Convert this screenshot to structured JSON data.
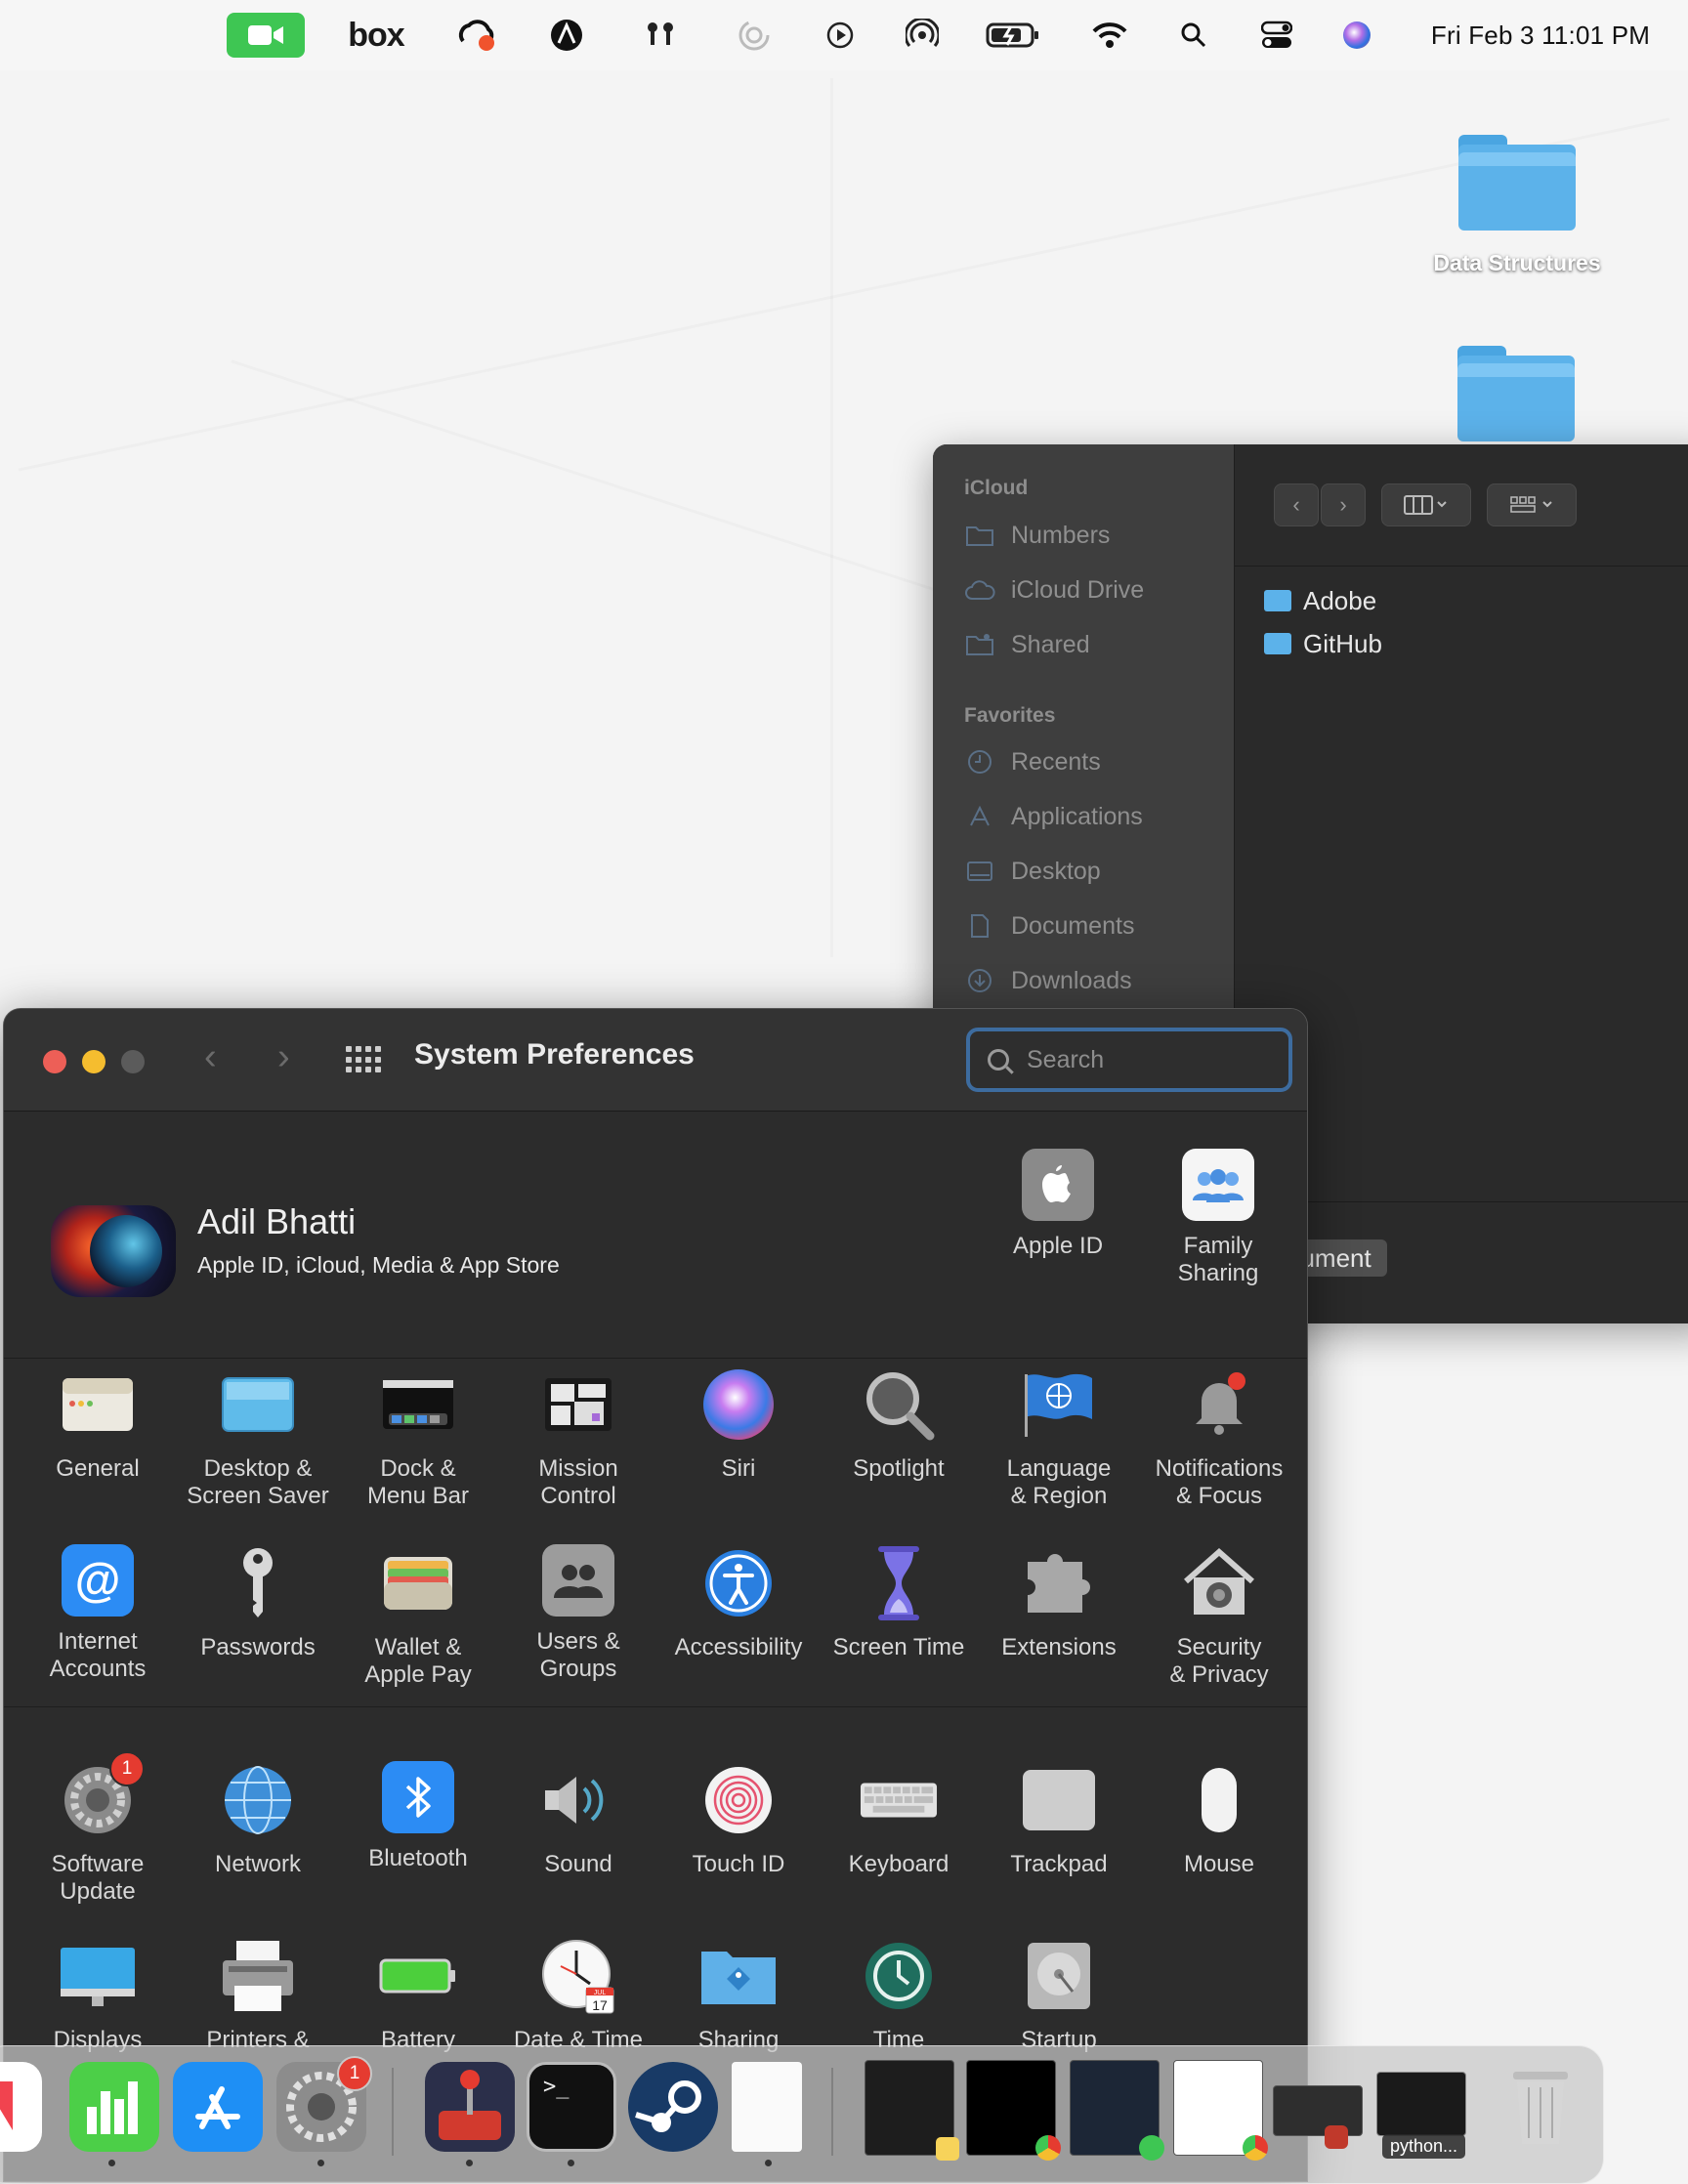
{
  "menubar": {
    "clock": "Fri Feb 3  11:01 PM",
    "box_label": "box",
    "icons": [
      "facetime-icon",
      "box-icon",
      "creative-cloud-icon",
      "cleanmymac-icon",
      "airpods-icon",
      "focus-icon",
      "play-icon",
      "airdrop-icon",
      "battery-icon",
      "wifi-icon",
      "search-icon",
      "control-center-icon",
      "siri-icon"
    ]
  },
  "desktop": {
    "folders": [
      {
        "label": "Data Structures"
      },
      {
        "label": ""
      }
    ]
  },
  "finder": {
    "sidebar": {
      "icloud_header": "iCloud",
      "icloud_items": [
        "Numbers",
        "iCloud Drive",
        "Shared"
      ],
      "favorites_header": "Favorites",
      "favorites_items": [
        "Recents",
        "Applications",
        "Desktop",
        "Documents",
        "Downloads"
      ]
    },
    "rows": [
      "Adobe",
      "GitHub"
    ],
    "new_document": "New Document"
  },
  "syspref": {
    "title": "System Preferences",
    "search_placeholder": "Search",
    "account": {
      "name": "Adil Bhatti",
      "subtitle": "Apple ID, iCloud, Media & App Store"
    },
    "top_items": [
      {
        "label": "Apple ID"
      },
      {
        "label": "Family\nSharing"
      }
    ],
    "row1": [
      "General",
      "Desktop &\nScreen Saver",
      "Dock &\nMenu Bar",
      "Mission\nControl",
      "Siri",
      "Spotlight",
      "Language\n& Region",
      "Notifications\n& Focus"
    ],
    "row2": [
      "Internet\nAccounts",
      "Passwords",
      "Wallet &\nApple Pay",
      "Users &\nGroups",
      "Accessibility",
      "Screen Time",
      "Extensions",
      "Security\n& Privacy"
    ],
    "row3": [
      "Software\nUpdate",
      "Network",
      "Bluetooth",
      "Sound",
      "Touch ID",
      "Keyboard",
      "Trackpad",
      "Mouse"
    ],
    "row4": [
      "Displays",
      "Printers &",
      "Battery",
      "Date & Time",
      "Sharing",
      "Time",
      "Startup"
    ],
    "software_update_badge": "1",
    "calendar_day": "17",
    "calendar_month": "JUL"
  },
  "dock": {
    "sysprefs_badge": "1",
    "python_label": "python..."
  },
  "colors": {
    "accent_blue": "#3d6c9f",
    "close_red": "#ed5f57",
    "minimize_yellow": "#f5bd2f",
    "badge_red": "#e53b30",
    "folder_blue": "#5cb2ea"
  }
}
